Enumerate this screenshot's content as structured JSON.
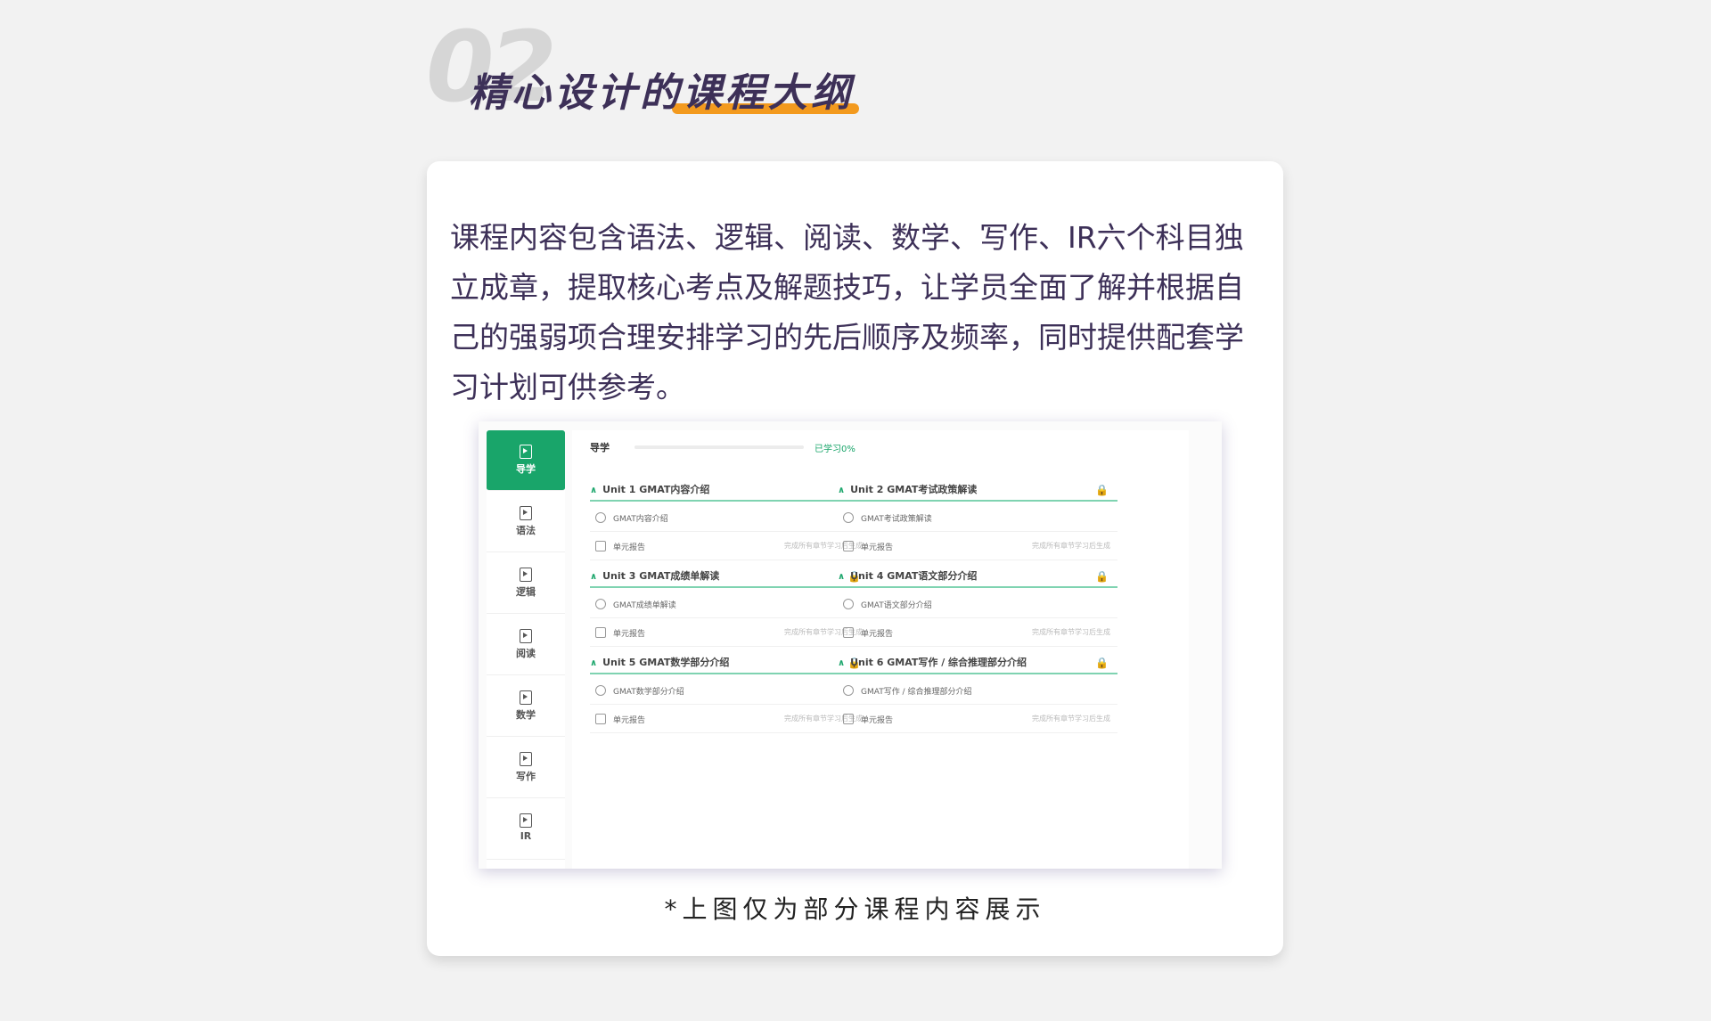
{
  "section": {
    "number": "02",
    "title": "精心设计的课程大纲"
  },
  "card": {
    "description": "课程内容包含语法、逻辑、阅读、数学、写作、IR六个科目独立成章，提取核心考点及解题技巧，让学员全面了解并根据自己的强弱项合理安排学习的先后顺序及频率，同时提供配套学习计划可供参考。",
    "caption": "*上图仅为部分课程内容展示"
  },
  "screenshot": {
    "sidebar": [
      "导学",
      "语法",
      "逻辑",
      "阅读",
      "数学",
      "写作",
      "IR"
    ],
    "active_tab": "导学",
    "topbar": {
      "title": "导学",
      "progress_label": "已学习0%",
      "progress": 0
    },
    "units": [
      {
        "title": "Unit 1 GMAT内容介绍",
        "locked": false,
        "lesson": "GMAT内容介绍",
        "report": "单元报告",
        "report_note": "完成所有章节学习后生成"
      },
      {
        "title": "Unit 2 GMAT考试政策解读",
        "locked": true,
        "lesson": "GMAT考试政策解读",
        "report": "单元报告",
        "report_note": "完成所有章节学习后生成"
      },
      {
        "title": "Unit 3 GMAT成绩单解读",
        "locked": true,
        "lesson": "GMAT成绩单解读",
        "report": "单元报告",
        "report_note": "完成所有章节学习后生成"
      },
      {
        "title": "Unit 4 GMAT语文部分介绍",
        "locked": true,
        "lesson": "GMAT语文部分介绍",
        "report": "单元报告",
        "report_note": "完成所有章节学习后生成"
      },
      {
        "title": "Unit 5 GMAT数学部分介绍",
        "locked": true,
        "lesson": "GMAT数学部分介绍",
        "report": "单元报告",
        "report_note": "完成所有章节学习后生成"
      },
      {
        "title": "Unit 6 GMAT写作 / 综合推理部分介绍",
        "locked": true,
        "lesson": "GMAT写作 / 综合推理部分介绍",
        "report": "单元报告",
        "report_note": "完成所有章节学习后生成"
      }
    ]
  },
  "colors": {
    "accent_green": "#19a56a",
    "underline_orange": "#f39a1e",
    "title_purple": "#3d3058"
  }
}
